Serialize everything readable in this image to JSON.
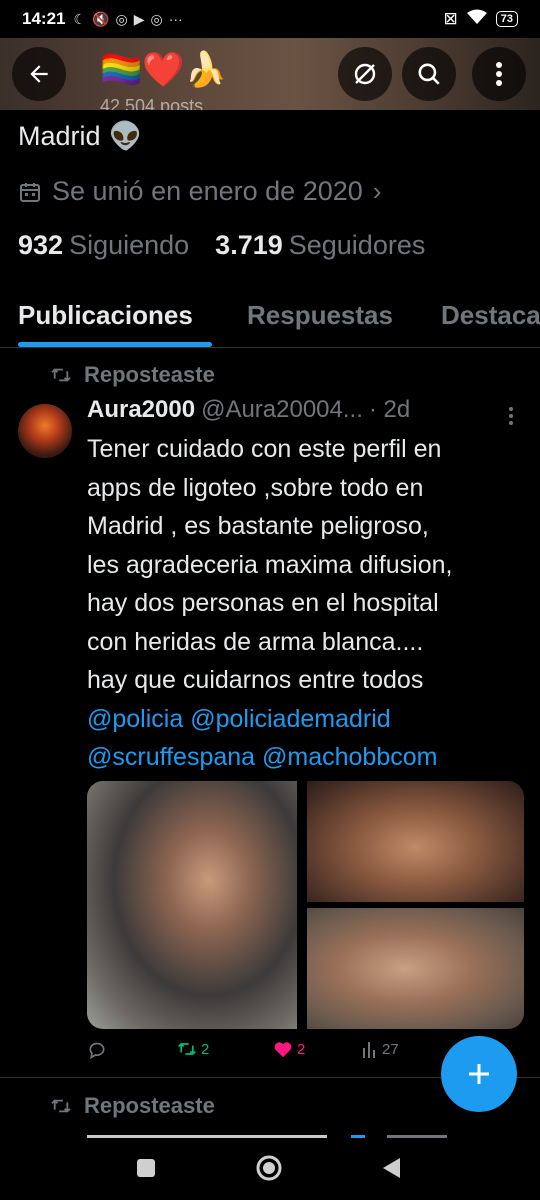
{
  "status_bar": {
    "time": "14:21",
    "battery": "73"
  },
  "header": {
    "emojis": "🏳️‍🌈❤️🍌",
    "posts_count": "42.504 posts"
  },
  "profile": {
    "location": "Madrid",
    "location_emoji": "👽",
    "joined": "Se unió en enero de 2020",
    "following_count": "932",
    "following_label": "Siguiendo",
    "followers_count": "3.719",
    "followers_label": "Seguidores"
  },
  "tabs": [
    {
      "label": "Publicaciones",
      "active": true
    },
    {
      "label": "Respuestas",
      "active": false
    },
    {
      "label": "Destacados",
      "active": false
    }
  ],
  "feed": {
    "repost_label": "Reposteaste",
    "tweet": {
      "name": "Aura2000",
      "handle": "@Aura20004...",
      "time": "· 2d",
      "text_lines": [
        "Tener cuidado con este perfil en",
        "apps de ligoteo ,sobre todo en",
        "Madrid , es bastante peligroso,",
        "les agradeceria maxima difusion,",
        "hay dos personas en el hospital",
        "con heridas de arma blanca....",
        "hay que cuidarnos entre todos"
      ],
      "mentions_line1": "@policia @policiademadrid",
      "mentions_line2": "@scruffespana @machobbcom",
      "reposts": "2",
      "likes": "2",
      "views": "27"
    },
    "next_repost_label": "Reposteaste"
  },
  "colors": {
    "accent": "#1d9bf0",
    "repost_green": "#00ba7c",
    "like_pink": "#f91880",
    "muted": "#71767b"
  }
}
